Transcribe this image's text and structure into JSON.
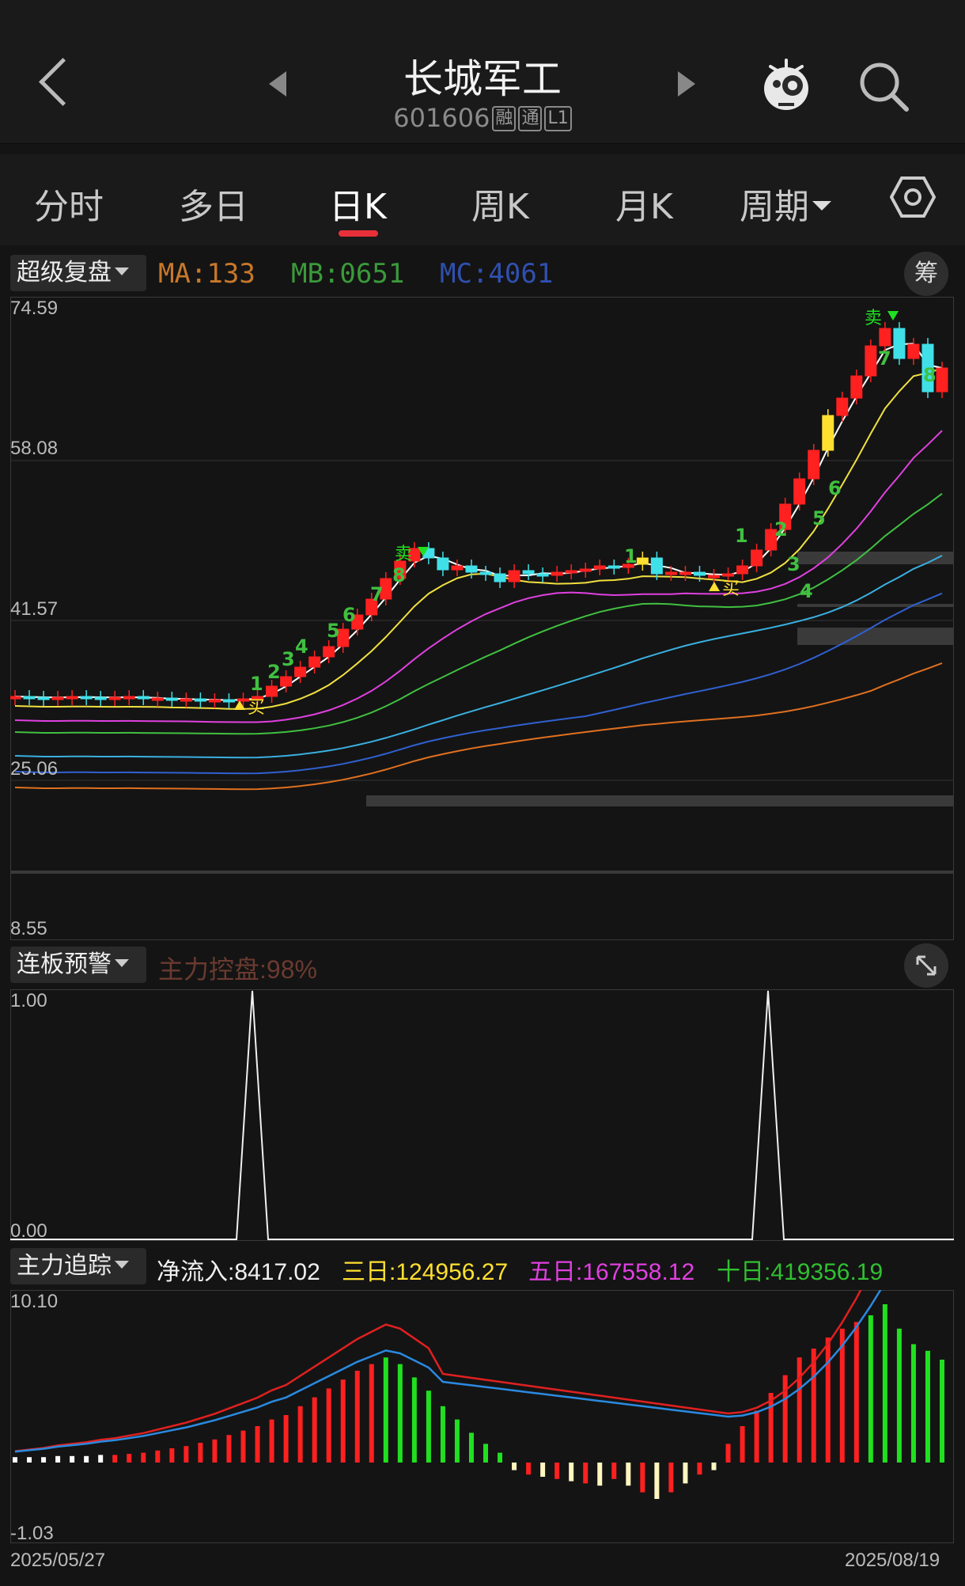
{
  "header": {
    "title": "长城军工",
    "code": "601606",
    "tags": [
      "融",
      "通",
      "L1"
    ]
  },
  "tabs": [
    {
      "label": "分时"
    },
    {
      "label": "多日"
    },
    {
      "label": "日K"
    },
    {
      "label": "周K"
    },
    {
      "label": "月K"
    },
    {
      "label": "周期"
    }
  ],
  "main_panel": {
    "dropdown": "超级复盘",
    "indicators": {
      "ma": "MA:133",
      "mb": "MB:0651",
      "mc": "MC:4061"
    },
    "chip_button": "筹",
    "y_labels": [
      "74.59",
      "58.08",
      "41.57",
      "25.06",
      "8.55"
    ],
    "signals": {
      "buy": "买",
      "sell": "卖"
    },
    "count_labels": [
      "1",
      "2",
      "3",
      "4",
      "5",
      "6",
      "7",
      "8",
      "1",
      "1",
      "2",
      "3",
      "4",
      "5",
      "6",
      "7",
      "8"
    ]
  },
  "panel2": {
    "dropdown": "连板预警",
    "indicator": "主力控盘:98%",
    "y_labels": [
      "1.00",
      "0.00"
    ]
  },
  "panel3": {
    "dropdown": "主力追踪",
    "net_inflow": "净流入:8417.02",
    "three_day": "三日:124956.27",
    "five_day": "五日:167558.12",
    "ten_day": "十日:419356.19",
    "y_labels": [
      "10.10",
      "-1.03"
    ],
    "x_labels": [
      "2025/05/27",
      "2025/08/19"
    ]
  },
  "colors": {
    "up": "#ff2020",
    "down": "#40e0e8",
    "ma_brown": "#c8782a",
    "mb_green": "#3a9a3a",
    "mc_blue": "#3050b0",
    "yellow": "#ffe030",
    "magenta": "#e040e0",
    "bright_green": "#20e020"
  }
}
